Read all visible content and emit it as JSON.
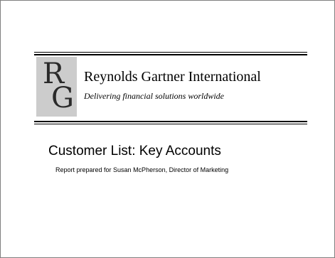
{
  "header": {
    "logo_letter_1": "R",
    "logo_letter_2": "G",
    "company_name": "Reynolds Gartner International",
    "tagline": "Delivering financial solutions worldwide"
  },
  "report": {
    "title": "Customer List: Key Accounts",
    "subtitle": "Report prepared for Susan McPherson, Director of Marketing"
  },
  "colors": {
    "logo_background": "#cccccc",
    "text": "#000000",
    "page_background": "#ffffff"
  }
}
